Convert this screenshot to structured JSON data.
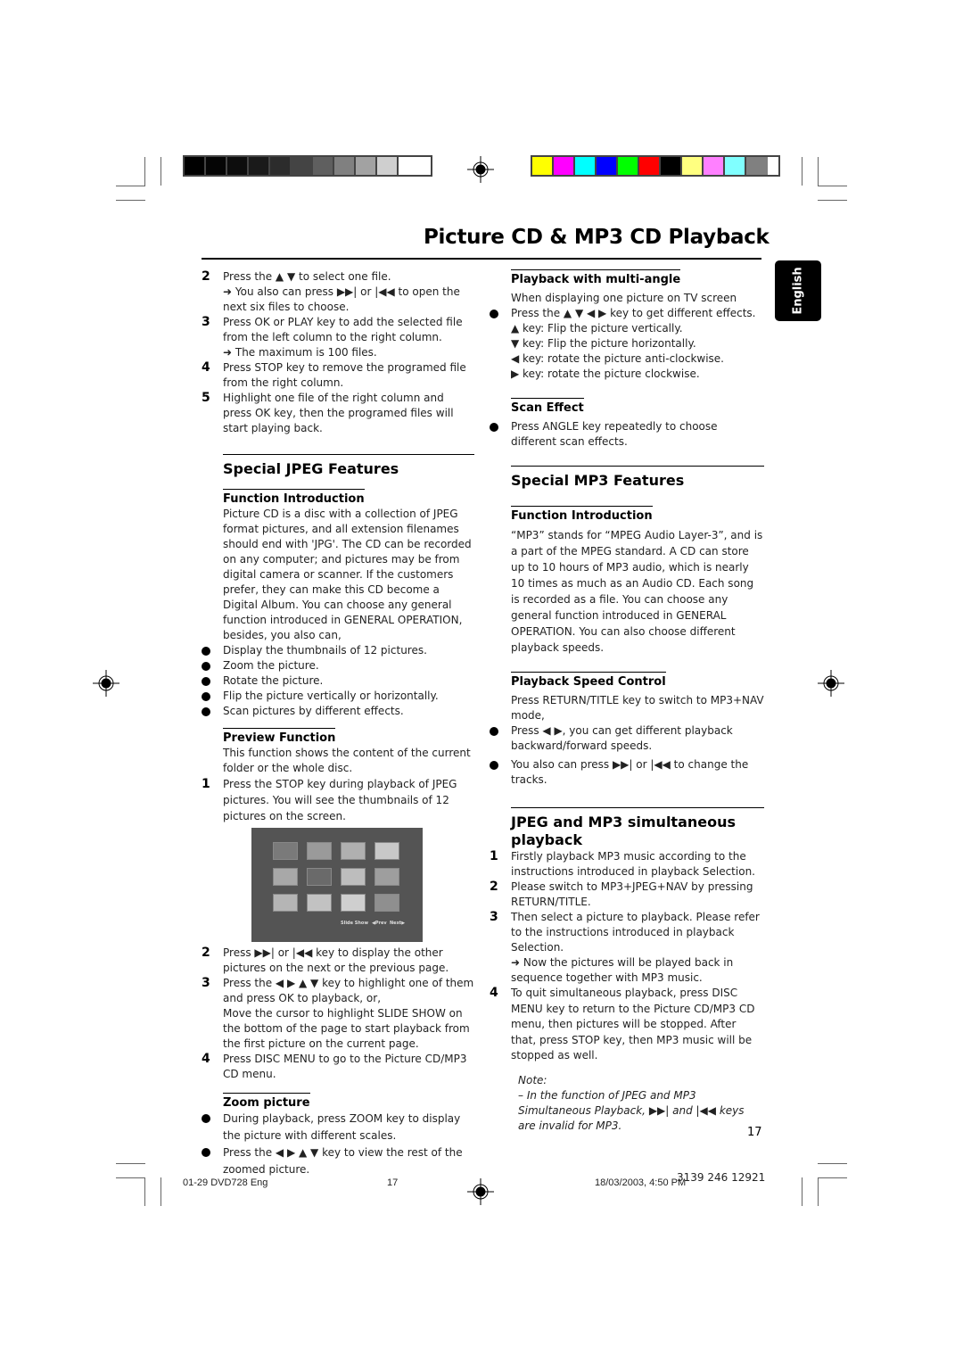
{
  "header": {
    "title": "Picture CD & MP3 CD Playback",
    "gray_strip": [
      "#000000",
      "#050505",
      "#0d0d0d",
      "#1a1a1a",
      "#2c2c2c",
      "#444444",
      "#5f5f5f",
      "#808080",
      "#a2a2a2",
      "#cfcfcf",
      "#ffffff"
    ],
    "color_strip": [
      "#ffff00",
      "#ff00ff",
      "#00ffff",
      "#0000ff",
      "#00ff00",
      "#ff0000",
      "#000000",
      "#ffff80",
      "#ff80ff",
      "#80ffff",
      "#808080"
    ]
  },
  "language_tab": "English",
  "left": {
    "intro_steps": [
      {
        "num": "2",
        "text": "Press the ▲ ▼  to select one file.",
        "sub": "➜ You also can press ▶▶| or |◀◀ to open the next six files to choose."
      },
      {
        "num": "3",
        "text": "Press OK or PLAY key to add the selected file from the left column to the right column.",
        "sub": "➜ The maximum is 100 files."
      },
      {
        "num": "4",
        "text": "Press STOP key to remove the programed file from the right column.",
        "sub": ""
      },
      {
        "num": "5",
        "text": "Highlight one file of the right column and press OK key, then the programed files will start playing back.",
        "sub": ""
      }
    ],
    "jpeg_section": {
      "heading": "Special JPEG Features",
      "func_intro_heading": "Function Introduction",
      "func_intro_text": "Picture CD is a disc with a collection of JPEG format pictures, and all extension filenames should end with 'JPG'. The CD can be recorded on any computer; and pictures may be from digital camera or scanner. If the customers prefer, they can make this CD become a Digital Album. You can choose any general function introduced in GENERAL OPERATION, besides, you also can,",
      "bullets": [
        "Display the thumbnails of 12 pictures.",
        "Zoom the picture.",
        "Rotate the picture.",
        "Flip the picture vertically or horizontally.",
        "Scan pictures by different effects."
      ],
      "preview_heading": "Preview Function",
      "preview_text": "This function shows the content of the current folder or the whole disc.",
      "preview_step1": {
        "num": "1",
        "text": "Press the STOP key during playback of JPEG pictures. You will see the thumbnails of 12 pictures on the screen."
      },
      "screen_labels": {
        "slide_show": "Slide Show",
        "prev": "◀Prev",
        "next": "Next▶"
      },
      "preview_steps": [
        {
          "num": "2",
          "text": "Press ▶▶| or |◀◀ key to display the other pictures on the next or the previous page."
        },
        {
          "num": "3",
          "text": "Press the ◀ ▶ ▲ ▼ key to highlight one of them and press OK to playback, or,",
          "extra": "Move the cursor  to highlight SLIDE SHOW on the bottom of the page to start playback from the first picture on the current page."
        },
        {
          "num": "4",
          "text": "Press DISC MENU to go to the Picture CD/MP3 CD menu."
        }
      ],
      "zoom_heading": "Zoom picture",
      "zoom_bullets": [
        "During playback, press ZOOM key to display the picture with different scales.",
        "Press the ◀ ▶ ▲ ▼ key to view the rest of  the zoomed picture."
      ]
    }
  },
  "right": {
    "multi_angle": {
      "heading": "Playback with multi-angle",
      "intro": "When displaying one picture on TV screen",
      "bullet": "Press the ▲ ▼ ◀ ▶  key to get different effects.",
      "keys": [
        "▲ key: Flip the picture vertically.",
        "▼ key: Flip the picture horizontally.",
        "◀ key: rotate the picture anti-clockwise.",
        "▶ key: rotate the picture clockwise."
      ]
    },
    "scan_effect": {
      "heading": "Scan Effect",
      "bullet": "Press ANGLE key repeatedly to choose different scan effects."
    },
    "mp3_section": {
      "heading": "Special MP3 Features",
      "func_intro_heading": "Function Introduction",
      "func_intro_text": "“MP3” stands for “MPEG Audio Layer-3”, and is a part of the MPEG standard. A CD can store up to 10 hours of MP3 audio, which is nearly 10 times as much as an Audio CD. Each song is recorded as a file. You can choose any general function introduced in GENERAL OPERATION. You can also choose different playback speeds.",
      "speed_heading": "Playback Speed Control",
      "speed_text": "Press RETURN/TITLE key to switch to MP3+NAV mode,",
      "speed_bullets": [
        "Press ◀ ▶, you can get different playback backward/forward speeds.",
        "You also can press ▶▶| or |◀◀ to change the tracks."
      ]
    },
    "simul": {
      "heading": "JPEG and MP3 simultaneous playback",
      "steps": [
        {
          "num": "1",
          "text": "Firstly playback MP3 music according to the instructions introduced in playback Selection.",
          "sub": ""
        },
        {
          "num": "2",
          "text": "Please switch to MP3+JPEG+NAV by pressing RETURN/TITLE.",
          "sub": ""
        },
        {
          "num": "3",
          "text": "Then select a picture to playback. Please refer to the instructions introduced in playback Selection.",
          "sub": "➜  Now the pictures will be played back in sequence together with MP3 music."
        },
        {
          "num": "4",
          "text": "To quit simultaneous playback, press DISC MENU key to return to the Picture CD/MP3 CD menu, then pictures will be stopped. After that, press STOP key, then MP3 music will be stopped as well.",
          "sub": ""
        }
      ],
      "note_label": "Note:",
      "note_text": "–   In the function of JPEG and MP3 Simultaneous Playback, ▶▶| and |◀◀ keys are invalid for MP3."
    }
  },
  "page_number": "17",
  "footer": {
    "file": "01-29 DVD728 Eng",
    "page": "17",
    "timestamp": "18/03/2003, 4:50 PM",
    "code": "3139 246 12921"
  }
}
